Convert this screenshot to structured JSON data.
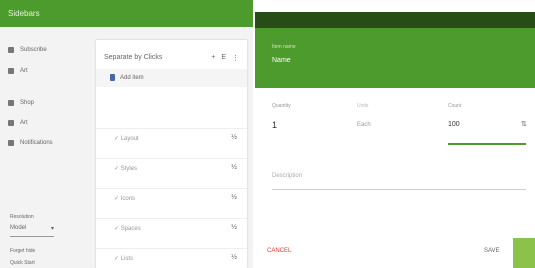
{
  "left": {
    "title": "Sidebars",
    "nav": [
      {
        "label": "Subscribe"
      },
      {
        "label": "Art"
      },
      {
        "label": "Shop"
      },
      {
        "label": "Art"
      },
      {
        "label": "Notifications"
      }
    ],
    "card": {
      "header": "Separate by Clicks",
      "actions": [
        "+",
        "E",
        "⋮"
      ],
      "selected": "Add item",
      "rows": [
        {
          "label": "✓ Layout",
          "value": "½"
        },
        {
          "label": "✓ Styles",
          "value": "½"
        },
        {
          "label": "✓ Icons",
          "value": "½"
        },
        {
          "label": "✓ Spaces",
          "value": "½"
        },
        {
          "label": "✓ Lists",
          "value": "½"
        }
      ]
    },
    "select": {
      "label": "Resolution",
      "value": "Model"
    },
    "footer": [
      "Forget hide",
      "Quick Start"
    ]
  },
  "dialog": {
    "title_label": "Item name",
    "title_value": "Name",
    "qty_label": "Quantity",
    "qty_value": "1",
    "unit_label": "Units",
    "unit_value": "Each",
    "count_label": "Count",
    "count_value": "100",
    "desc_placeholder": "Description",
    "cancel": "CANCEL",
    "save": "SAVE"
  },
  "colors": {
    "primary": "#4d9b2c",
    "dark": "#284c17",
    "accent_red": "#e53935",
    "accent_light": "#8bc34a"
  }
}
